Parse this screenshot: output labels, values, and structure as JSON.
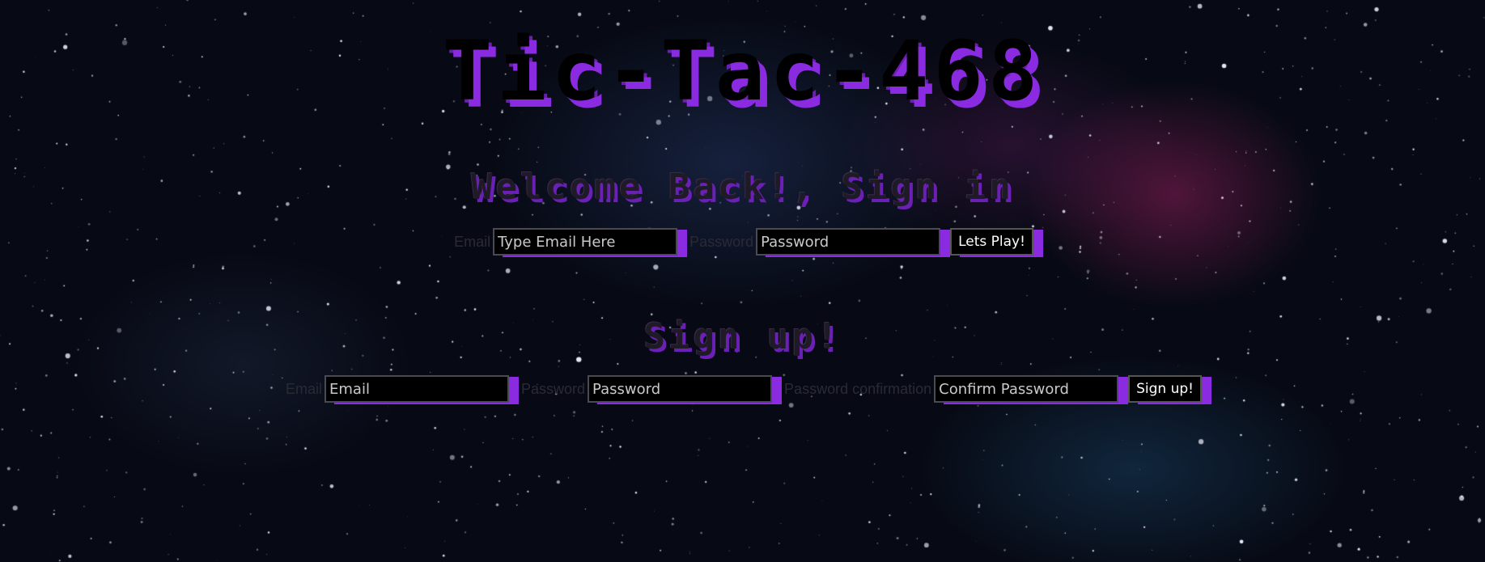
{
  "title": "Tic-Tac-468",
  "signin": {
    "heading": "Welcome Back!, Sign in",
    "email_label": "Email",
    "email_placeholder": "Type Email Here",
    "password_label": "Password",
    "password_placeholder": "Password",
    "button_label": "Lets Play!"
  },
  "signup": {
    "heading": "Sign up!",
    "email_label": "Email",
    "email_placeholder": "Email",
    "password_label": "Password",
    "password_placeholder": "Password",
    "confirm_label": "Password confirmation",
    "confirm_placeholder": "Confirm Password",
    "button_label": "Sign up!"
  },
  "colors": {
    "accent": "#8a2be2",
    "background": "#070a14"
  }
}
